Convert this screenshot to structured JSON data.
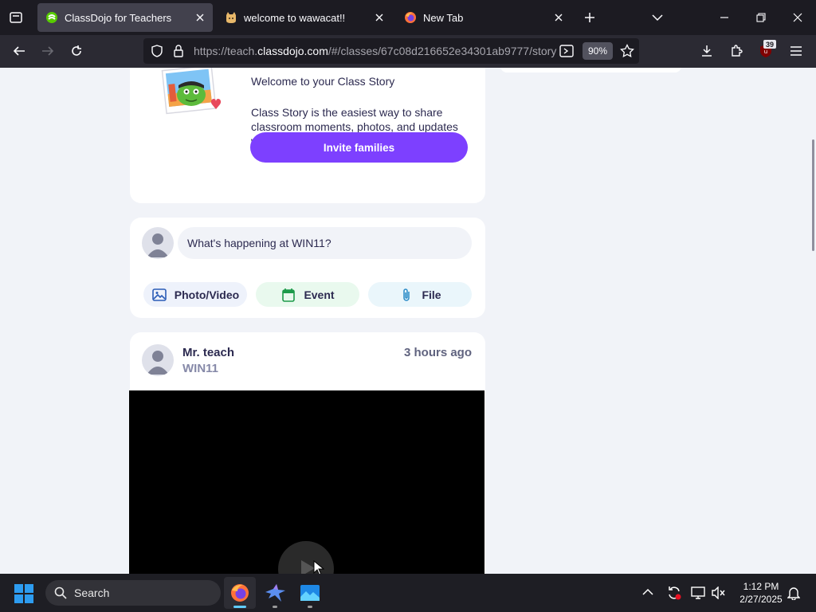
{
  "browser": {
    "tabs": [
      {
        "title": "ClassDojo for Teachers",
        "active": true,
        "favicon": "classdojo-icon"
      },
      {
        "title": "welcome to wawacat!!",
        "active": false,
        "favicon": "cat-icon"
      },
      {
        "title": "New Tab",
        "active": false,
        "favicon": "firefox-icon"
      }
    ],
    "url": {
      "prefix": "https://teach.",
      "domain": "classdojo.com",
      "path": "/#/classes/67c08d216652e34301ab9777/story"
    },
    "zoom": "90%",
    "extension_badge": "39"
  },
  "page": {
    "welcome": {
      "title": "Welcome to your Class Story",
      "description": "Class Story is the easiest way to share classroom moments, photos, and updates with parents.",
      "invite_button": "Invite families"
    },
    "composer": {
      "placeholder": "What's happening at WIN11?",
      "actions": [
        {
          "label": "Photo/Video",
          "icon": "image-icon",
          "color": "#eef2fb"
        },
        {
          "label": "Event",
          "icon": "calendar-icon",
          "color": "#e9f9ee"
        },
        {
          "label": "File",
          "icon": "paperclip-icon",
          "color": "#eaf6fb"
        }
      ]
    },
    "post": {
      "author": "Mr. teach",
      "class_name": "WIN11",
      "time": "3 hours ago"
    }
  },
  "taskbar": {
    "search_label": "Search",
    "time": "1:12 PM",
    "date": "2/27/2025"
  },
  "colors": {
    "accent": "#7d40ff",
    "page_bg": "#f1f3f8",
    "text": "#2c2a50"
  }
}
